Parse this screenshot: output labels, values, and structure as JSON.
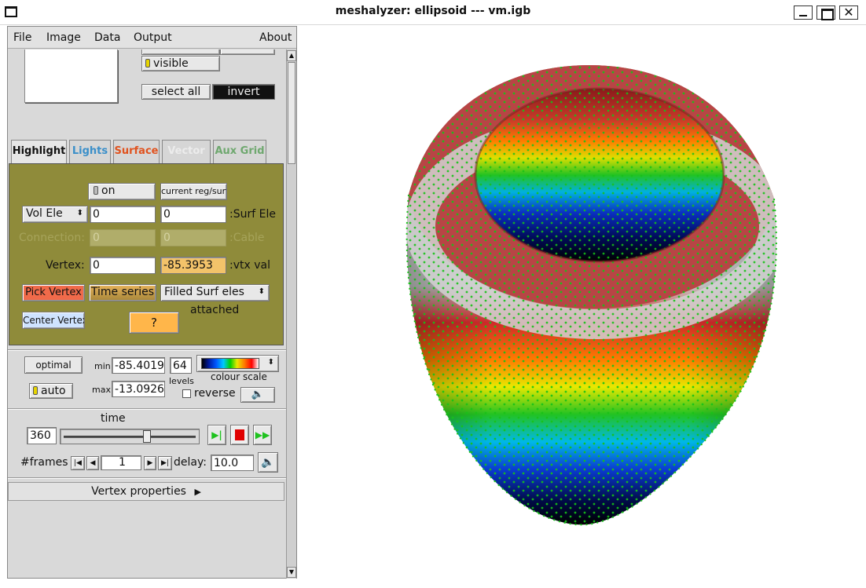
{
  "window": {
    "title": "meshalyzer: ellipsoid --- vm.igb"
  },
  "menu": [
    "File",
    "Image",
    "Data",
    "Output",
    "About"
  ],
  "region": {
    "visible_label": "visible",
    "select_all_label": "select all",
    "invert_label": "invert"
  },
  "tabs": [
    {
      "label": "Highlight",
      "color": "#111111"
    },
    {
      "label": "Lights",
      "color": "#3b8fc9"
    },
    {
      "label": "Surface",
      "color": "#e0531f"
    },
    {
      "label": "Vector",
      "color": "#eeeeee"
    },
    {
      "label": "Aux Grid",
      "color": "#6fa86f"
    }
  ],
  "highlight": {
    "on_label": "on",
    "current_label": "current reg/surf",
    "vol_ele_select": "Vol Ele",
    "vol_ele_value": "0",
    "surf_ele_value": "0",
    "surf_ele_label": ":Surf Ele",
    "connection_label": "Connection:",
    "connection_value": "0",
    "cable_value": "0",
    "cable_label": ":Cable",
    "vertex_label": "Vertex:",
    "vertex_value": "0",
    "vtx_val_value": "-85.3953",
    "vtx_val_label": ":vtx val",
    "pick_vertex_label": "Pick Vertex",
    "time_series_label": "Time series",
    "filled_surf_select": "Filled Surf eles",
    "attached_label": "attached",
    "center_vertex_label": "Center Vertex",
    "help_label": "?"
  },
  "colour": {
    "optimal_label": "optimal",
    "auto_label": "auto",
    "min_label": "min",
    "min_value": "-85.4019",
    "max_label": "max",
    "max_value": "-13.0926",
    "levels_value": "64",
    "levels_label": "levels",
    "scale_label": "colour scale",
    "reverse_label": "reverse"
  },
  "time": {
    "label": "time",
    "value": "360",
    "slider_fraction": 0.63,
    "frames_label": "#frames",
    "frame_value": "1",
    "delay_label": "delay:",
    "delay_value": "10.0"
  },
  "vertex_properties_label": "Vertex properties",
  "colors": {
    "panel_olive": "#8f8b3a",
    "vtx_field": "#f3c36a",
    "pick_vertex": "#f06a4a",
    "help": "#ffb64a",
    "center_vertex": "#cfe3ff"
  }
}
